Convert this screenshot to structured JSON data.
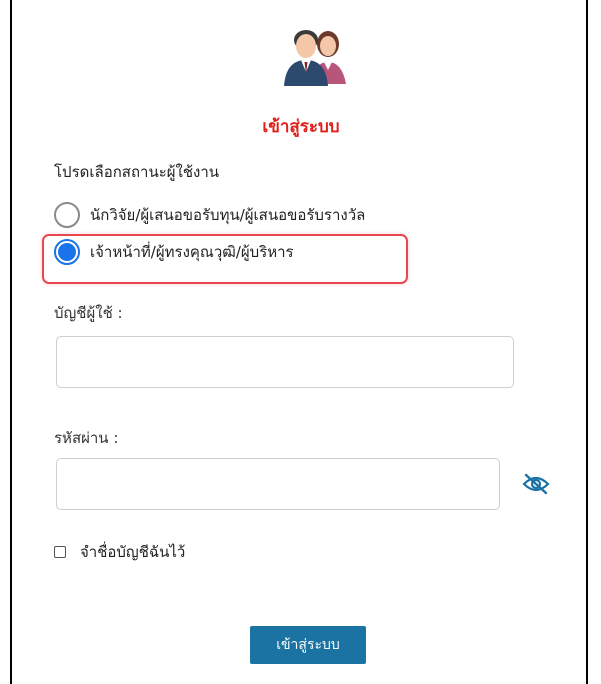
{
  "header": {
    "title": "เข้าสู่ระบบ",
    "avatar_icon": "users-icon"
  },
  "role_prompt": "โปรดเลือกสถานะผู้ใช้งาน",
  "roles": [
    {
      "label": "นักวิจัย/ผู้เสนอขอรับทุน/ผู้เสนอขอรับรางวัล",
      "checked": false
    },
    {
      "label": "เจ้าหน้าที่/ผู้ทรงคุณวุฒิ/ผู้บริหาร",
      "checked": true
    }
  ],
  "username": {
    "label": "บัญชีผู้ใช้ :",
    "value": ""
  },
  "password": {
    "label": "รหัสผ่าน :",
    "value": "",
    "toggle_icon": "eye-slash-icon"
  },
  "remember": {
    "label": "จำชื่อบัญชีฉันไว้",
    "checked": false
  },
  "submit_label": "เข้าสู่ระบบ",
  "colors": {
    "title": "#e0201b",
    "radio_accent": "#1a73e8",
    "highlight_border": "#e8474e",
    "button_bg": "#1a73a3",
    "eye_icon": "#1a73a3"
  }
}
